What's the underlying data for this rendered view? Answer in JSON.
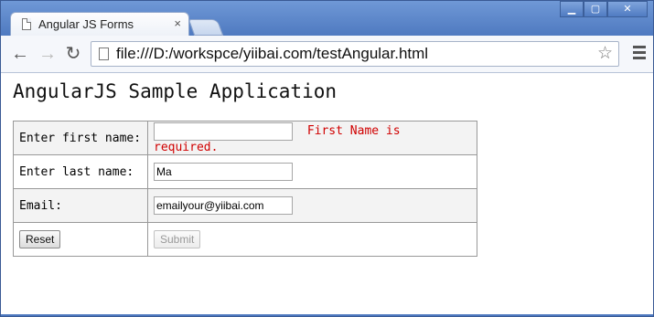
{
  "browser": {
    "tab_title": "Angular JS Forms",
    "tab_close": "×",
    "url": "file:///D:/workspce/yiibai.com/testAngular.html",
    "back": "←",
    "forward": "→",
    "reload": "↻",
    "star": "☆",
    "minimize": "▁",
    "maximize": "▢",
    "close": "✕"
  },
  "page": {
    "heading": "AngularJS Sample Application",
    "form": {
      "first_name_label": "Enter first name:",
      "first_name_value": "",
      "first_name_error": "First Name is required.",
      "last_name_label": "Enter last name:",
      "last_name_value": "Ma",
      "email_label": "Email:",
      "email_value": "emailyour@yiibai.com",
      "reset_label": "Reset",
      "submit_label": "Submit",
      "submit_disabled": true
    }
  },
  "colors": {
    "error": "#d00000",
    "chrome_frame": "#4d78bf"
  }
}
